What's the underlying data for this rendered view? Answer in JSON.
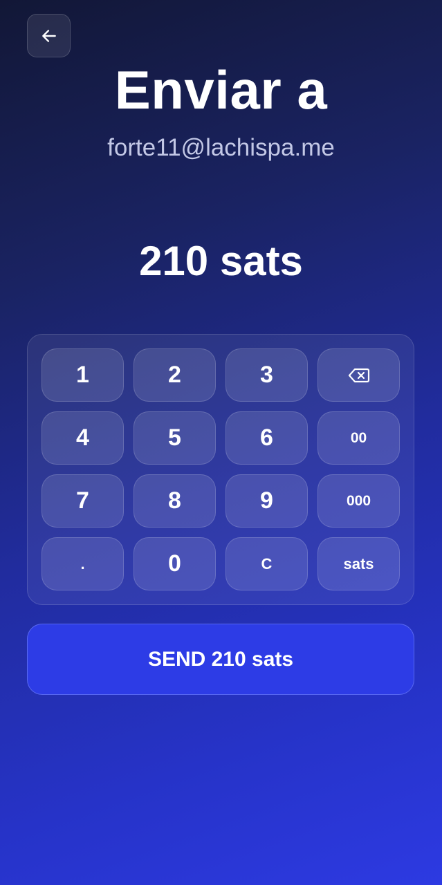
{
  "header": {
    "back_icon": "arrow-left-icon",
    "title": "Enviar a",
    "recipient": "forte11@lachispa.me"
  },
  "amount_display": "210 sats",
  "keypad": {
    "keys": [
      "1",
      "2",
      "3",
      "backspace",
      "4",
      "5",
      "6",
      "00",
      "7",
      "8",
      "9",
      "000",
      ".",
      "0",
      "C",
      "sats"
    ],
    "backspace_icon": "backspace-icon"
  },
  "send_button": {
    "label": "SEND 210 sats"
  },
  "colors": {
    "background_top": "#121736",
    "background_bottom": "#2d3ae2",
    "send_button": "#2d3ce6",
    "recipient_text": "#c3c8e6"
  }
}
